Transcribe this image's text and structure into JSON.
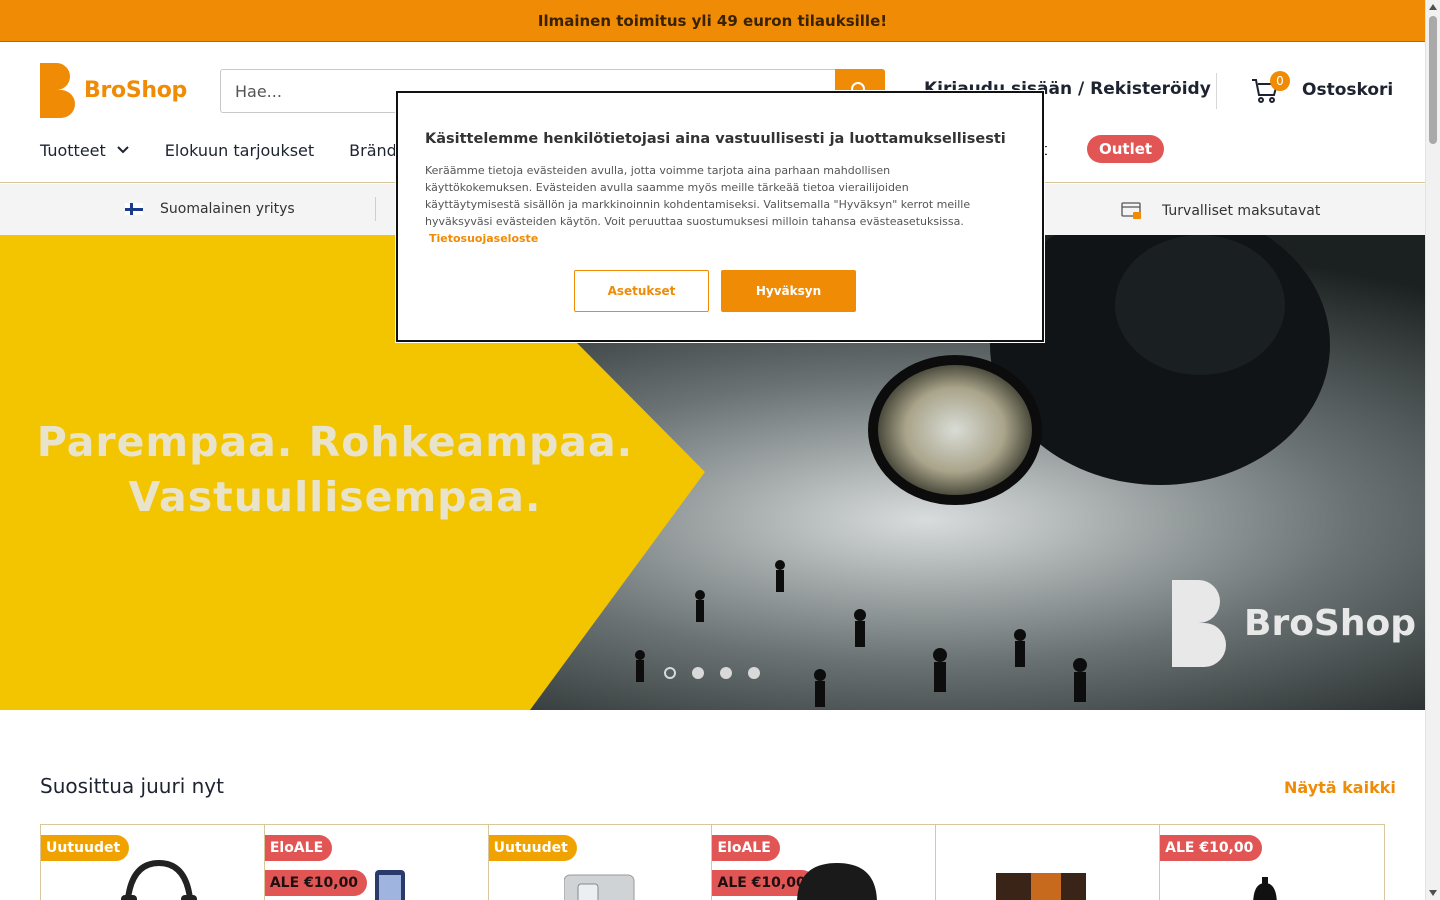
{
  "announcement": "Ilmainen toimitus yli 49 euron tilauksille!",
  "brand": {
    "name": "BroShop",
    "color": "#ef8b05"
  },
  "search": {
    "placeholder": "Hae..."
  },
  "account": {
    "login_label": "Kirjaudu sisään / Rekisteröidy"
  },
  "cart": {
    "label": "Ostoskori",
    "count": "0"
  },
  "nav": {
    "items": [
      {
        "label": "Tuotteet"
      },
      {
        "label": "Elokuun tarjoukset"
      },
      {
        "label": "Brändit"
      }
    ],
    "hidden_tail": "t",
    "outlet": "Outlet"
  },
  "trust": {
    "left": "Suomalainen yritys",
    "right": "Turvalliset maksutavat"
  },
  "hero": {
    "line1": "Parempaa. Rohkeampaa.",
    "line2": "Vastuullisempaa.",
    "brand_text": "BroShop",
    "slide_count": 4,
    "active_slide": 1
  },
  "popular": {
    "title": "Suosittua juuri nyt",
    "view_all": "Näytä kaikki",
    "cards": [
      {
        "badge": "Uutuudet",
        "badge_type": "new",
        "sale": ""
      },
      {
        "badge": "EloALE",
        "badge_type": "promo",
        "sale": "ALE €10,00"
      },
      {
        "badge": "Uutuudet",
        "badge_type": "new",
        "sale": ""
      },
      {
        "badge": "EloALE",
        "badge_type": "promo",
        "sale": "ALE €10,00"
      },
      {
        "badge": "",
        "badge_type": "",
        "sale": ""
      },
      {
        "badge": "ALE €10,00",
        "badge_type": "sale-top",
        "sale": ""
      }
    ]
  },
  "cookie_modal": {
    "title": "Käsittelemme henkilötietojasi aina vastuullisesti ja luottamuksellisesti",
    "body": "Keräämme tietoja evästeiden avulla, jotta voimme tarjota aina parhaan mahdollisen käyttökokemuksen. Evästeiden avulla saamme myös meille tärkeää tietoa vierailijoiden käyttäytymisestä sisällön ja markkinoinnin kohdentamiseksi. Valitsemalla \"Hyväksyn\" kerrot meille hyväksyväsi evästeiden käytön. Voit peruuttaa suostumuksesi milloin tahansa evästeasetuksissa.",
    "link": "Tietosuojaseloste",
    "settings_button": "Asetukset",
    "accept_button": "Hyväksyn"
  }
}
